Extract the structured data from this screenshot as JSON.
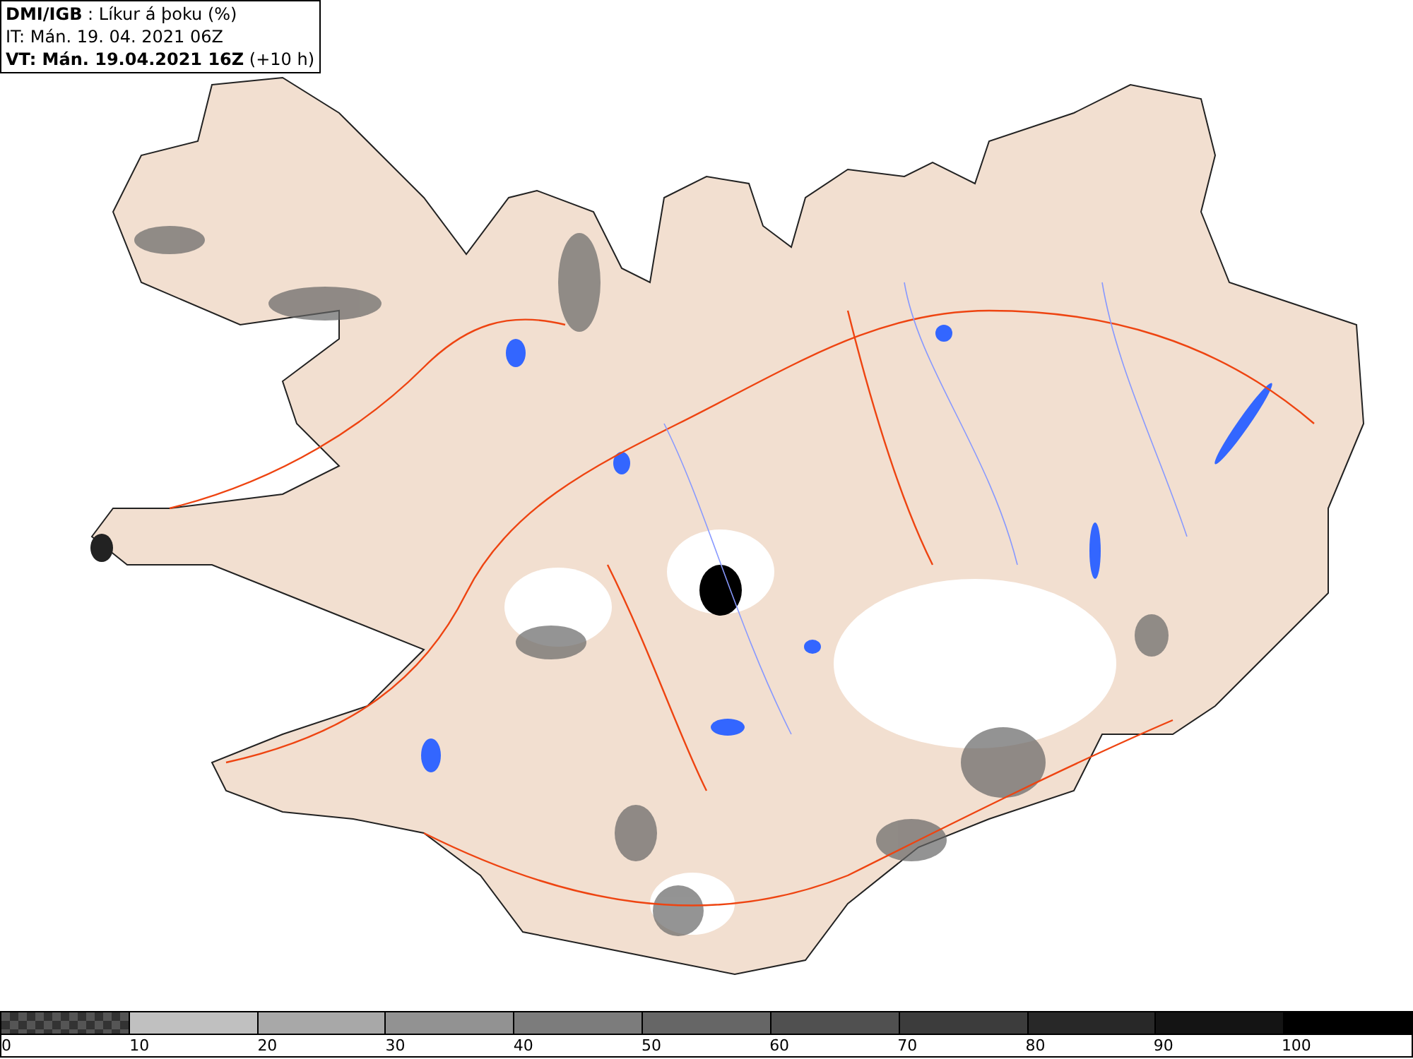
{
  "header": {
    "title": "**DMI/IGB** : Líkur á þoku (%)",
    "issue_time": "IT: Mán. 19. 04. 2021 06Z",
    "valid_time": "**VT: Mán. 19.04.2021 16Z** (+10 h)"
  },
  "legend": {
    "segments": [
      {
        "kind": "checker",
        "color": "#555555"
      },
      {
        "kind": "solid",
        "color": "#c0c0c0"
      },
      {
        "kind": "solid",
        "color": "#a8a8a8"
      },
      {
        "kind": "solid",
        "color": "#929292"
      },
      {
        "kind": "solid",
        "color": "#7c7c7c"
      },
      {
        "kind": "solid",
        "color": "#666666"
      },
      {
        "kind": "solid",
        "color": "#505050"
      },
      {
        "kind": "solid",
        "color": "#3c3c3c"
      },
      {
        "kind": "solid",
        "color": "#282828"
      },
      {
        "kind": "solid",
        "color": "#141414"
      },
      {
        "kind": "solid",
        "color": "#000000"
      }
    ],
    "labels": [
      "0",
      "10",
      "20",
      "30",
      "40",
      "50",
      "60",
      "70",
      "80",
      "90",
      "100"
    ]
  }
}
